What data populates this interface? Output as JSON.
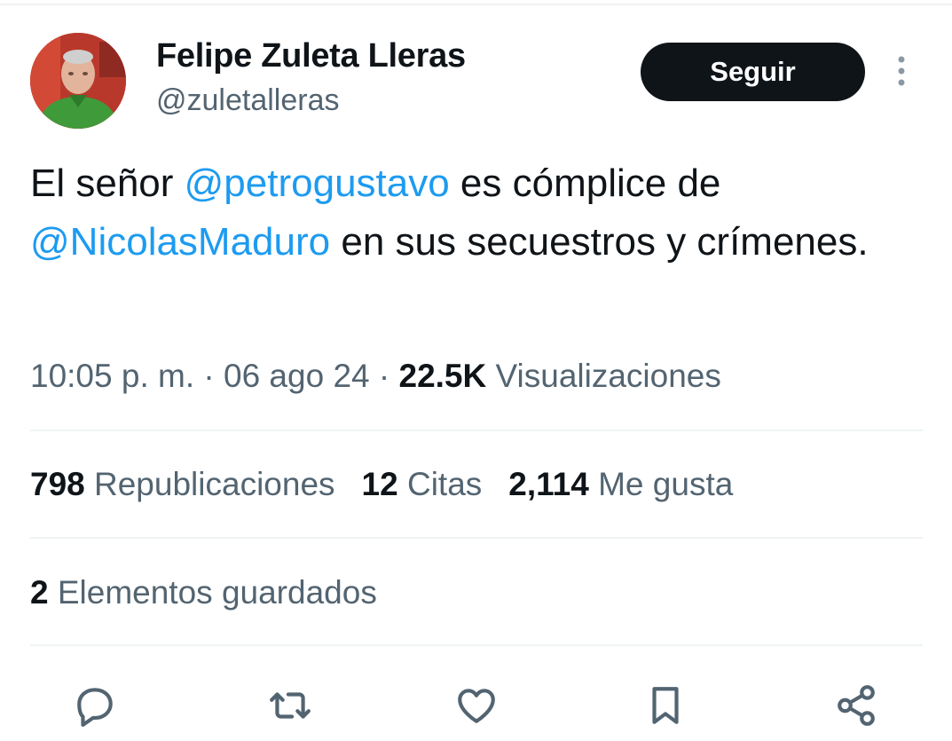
{
  "author": {
    "display_name": "Felipe Zuleta Lleras",
    "handle": "@zuletalleras",
    "avatar_icon": "avatar-photo"
  },
  "follow_button": {
    "label": "Seguir"
  },
  "more_icon": "more-vertical-icon",
  "tweet": {
    "parts": [
      {
        "text": "El señor ",
        "type": "text"
      },
      {
        "text": "@petrogustavo",
        "type": "mention"
      },
      {
        "text": " es cómplice de ",
        "type": "text"
      },
      {
        "text": "@NicolasMaduro",
        "type": "mention"
      },
      {
        "text": " en sus secuestros y crímenes.",
        "type": "text"
      }
    ]
  },
  "meta": {
    "time": "10:05 p. m.",
    "sep1": " · ",
    "date": "06 ago 24",
    "sep2": " · ",
    "views_count": "22.5K",
    "views_label": " Visualizaciones"
  },
  "stats": {
    "reposts_count": "798",
    "reposts_label": " Republicaciones",
    "quotes_count": "12",
    "quotes_label": " Citas",
    "likes_count": "2,114",
    "likes_label": " Me gusta"
  },
  "saved": {
    "count": "2",
    "label": " Elementos guardados"
  },
  "actions": [
    "reply-icon",
    "repost-icon",
    "like-icon",
    "bookmark-icon",
    "share-icon"
  ],
  "colors": {
    "mention": "#1d9bf0",
    "text_primary": "#0f1419",
    "text_secondary": "#536471",
    "button_bg": "#0f1419",
    "divider": "#eff3f4"
  }
}
